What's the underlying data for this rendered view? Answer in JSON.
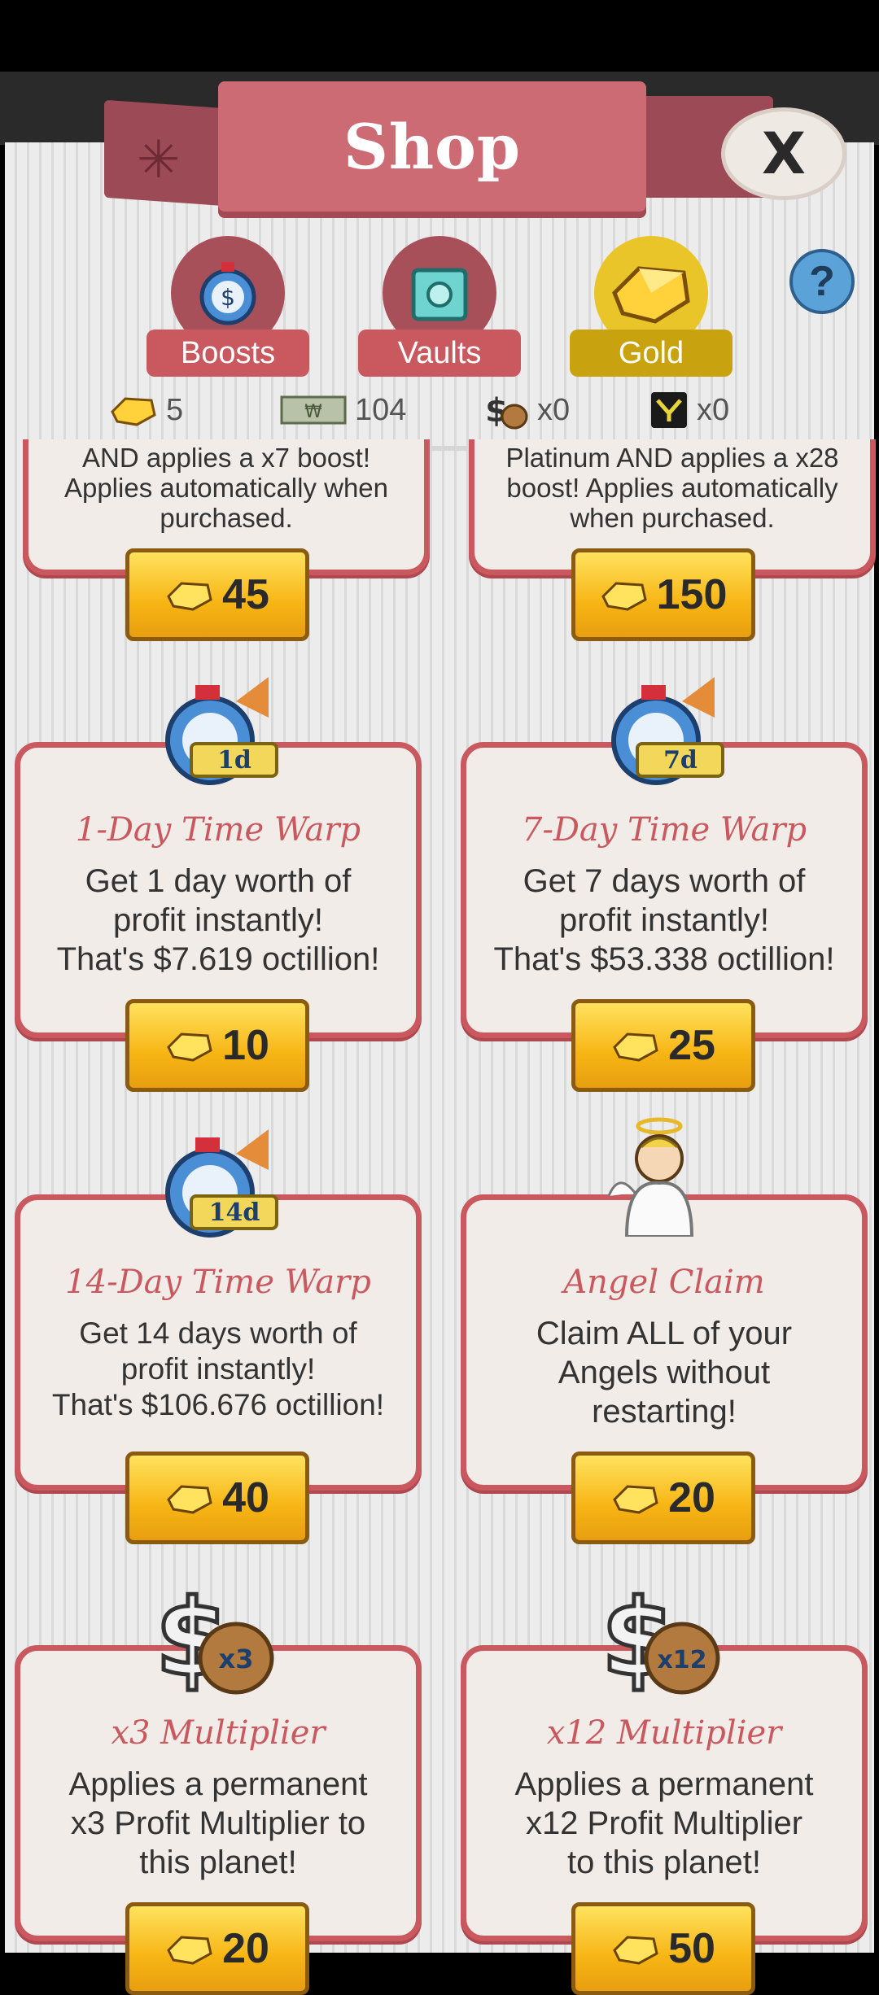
{
  "header": {
    "title": "Shop",
    "close_label": "X"
  },
  "tabs": [
    {
      "label": "Boosts",
      "color": "#c9585f"
    },
    {
      "label": "Vaults",
      "color": "#c9585f"
    },
    {
      "label": "Gold",
      "color": "#c9a20f"
    }
  ],
  "help": {
    "label": "?"
  },
  "currencies": [
    {
      "icon": "gold-gem-icon",
      "value": "5"
    },
    {
      "icon": "megabucks-icon",
      "value": "104"
    },
    {
      "icon": "money-bag-icon",
      "value": "x0"
    },
    {
      "icon": "item-box-icon",
      "value": "x0"
    }
  ],
  "cards": [
    {
      "title": "",
      "desc_line1": "AND applies a x7 boost!",
      "desc_line2": "Applies automatically when",
      "desc_line3": "purchased.",
      "price": "45"
    },
    {
      "title": "",
      "desc_line1": "Platinum AND applies a x28",
      "desc_line2": "boost! Applies automatically",
      "desc_line3": "when purchased.",
      "price": "150"
    },
    {
      "title": "1-Day Time Warp",
      "badge": "1d",
      "desc_line1": "Get 1 day worth of",
      "desc_line2": "profit instantly!",
      "desc_line3": "That's $7.619 octillion!",
      "price": "10"
    },
    {
      "title": "7-Day Time Warp",
      "badge": "7d",
      "desc_line1": "Get 7 days worth of",
      "desc_line2": "profit instantly!",
      "desc_line3": "That's $53.338 octillion!",
      "price": "25"
    },
    {
      "title": "14-Day Time Warp",
      "badge": "14d",
      "desc_line1": "Get 14 days worth of",
      "desc_line2": "profit instantly!",
      "desc_line3": "That's $106.676 octillion!",
      "price": "40"
    },
    {
      "title": "Angel Claim",
      "desc_line1": "Claim ALL of your",
      "desc_line2": "Angels without",
      "desc_line3": "restarting!",
      "price": "20"
    },
    {
      "title": "x3 Multiplier",
      "badge": "x3",
      "desc_line1": "Applies a permanent",
      "desc_line2": "x3 Profit Multiplier to",
      "desc_line3": "this planet!",
      "price": "20"
    },
    {
      "title": "x12 Multiplier",
      "badge": "x12",
      "desc_line1": "Applies a permanent",
      "desc_line2": "x12 Profit Multiplier",
      "desc_line3": "to this planet!",
      "price": "50"
    }
  ]
}
